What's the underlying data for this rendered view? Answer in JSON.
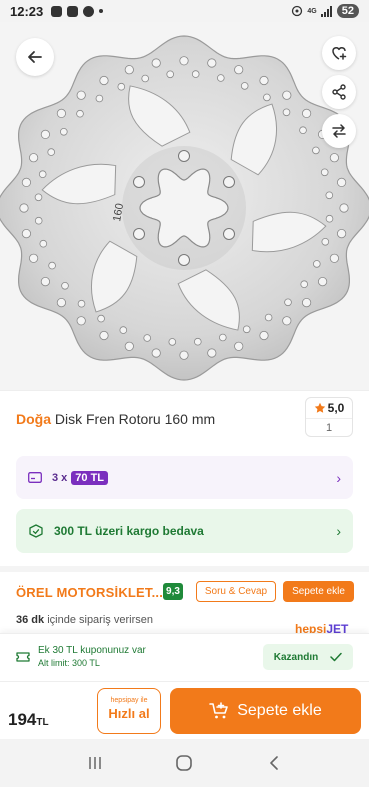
{
  "status_bar": {
    "time": "12:23",
    "network": "4G",
    "battery": "52"
  },
  "product": {
    "image_label": "160",
    "brand": "Doğa",
    "name": "Disk Fren Rotoru 160 mm",
    "rating": "5,0",
    "rating_count": "1"
  },
  "installment": {
    "prefix": "3 x",
    "amount": "70 TL"
  },
  "cargo": {
    "text": "300 TL üzeri kargo bedava"
  },
  "seller": {
    "name": "ÖREL MOTORSİKLET...",
    "score": "9,3",
    "qa_label": "Soru & Cevap",
    "add_label": "Sepete ekle",
    "delivery_bold": "36 dk",
    "delivery_rest": "içinde sipariş verirsen",
    "logo_hepsi": "hepsi",
    "logo_jet": "JET"
  },
  "coupon": {
    "line1": "Ek 30 TL kuponunuz var",
    "line2": "Alt limit: 300 TL",
    "button": "Kazandın"
  },
  "bottom": {
    "price": "194",
    "currency": "TL",
    "hizli_small": "hepsipay ile",
    "hizli_big": "Hızlı al",
    "add_to_cart": "Sepete ekle"
  },
  "icons": {
    "back": "arrow-left-icon",
    "favorite": "heart-plus-icon",
    "share": "share-icon",
    "compare": "swap-arrows-icon",
    "star": "star-icon",
    "cart": "cart-plus-icon"
  },
  "colors": {
    "brand_orange": "#f27a1a",
    "installment_purple": "#7b2fbe",
    "cargo_green": "#1f7a34"
  }
}
